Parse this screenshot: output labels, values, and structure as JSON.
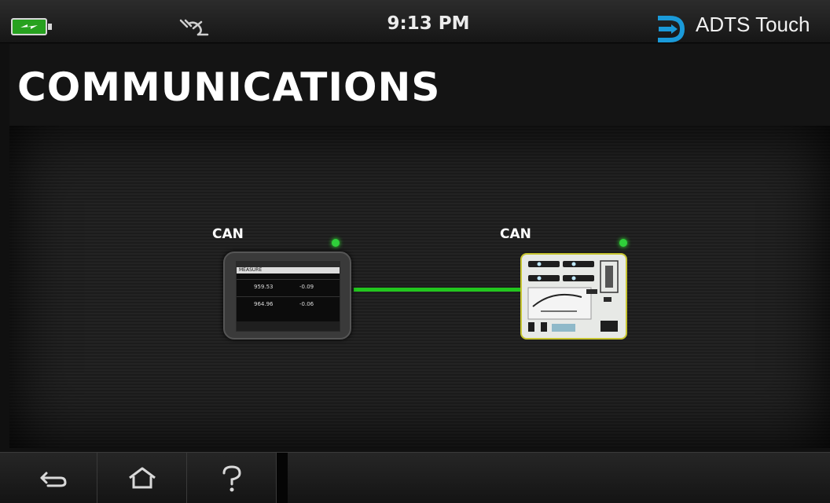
{
  "status_bar": {
    "time": "9:13 PM",
    "app_name": "ADTS Touch",
    "battery_icon": "battery-charging-icon",
    "usb_icon": "usb-disconnected-icon",
    "brand_color": "#1a9ad9"
  },
  "page": {
    "title": "COMMUNICATIONS"
  },
  "devices": [
    {
      "label": "CAN",
      "status_color": "#2fcf3a"
    },
    {
      "label": "CAN",
      "status_color": "#2fcf3a"
    }
  ],
  "tablet_screen": {
    "header": "MEASURE",
    "rows": [
      {
        "value_a": "959.53",
        "value_b": "-0.09"
      },
      {
        "value_a": "964.96",
        "value_b": "-0.06"
      }
    ]
  },
  "link": {
    "color": "#22c61e",
    "state": "connected"
  },
  "nav": {
    "back_icon": "back-arrow-icon",
    "home_icon": "home-icon",
    "help_icon": "help-icon"
  }
}
